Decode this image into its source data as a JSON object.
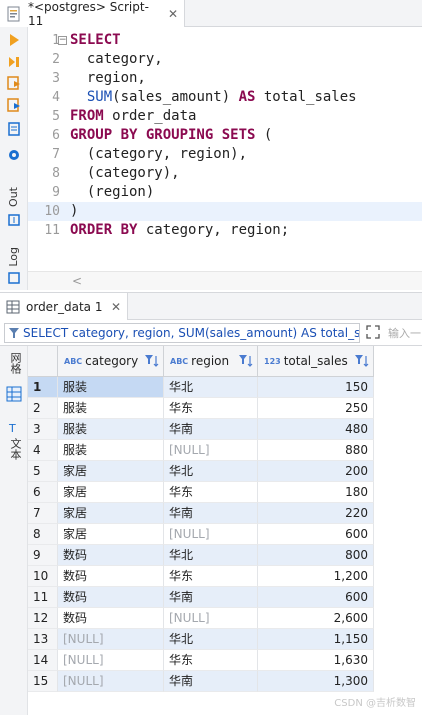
{
  "editor_tab": {
    "title": "*<postgres> Script-11",
    "close": "✕"
  },
  "left_toolbar": {
    "out_label": "Out",
    "log_label": "Log"
  },
  "sql_lines": [
    {
      "num": "1",
      "tokens": [
        {
          "t": "SELECT",
          "c": "kw"
        }
      ]
    },
    {
      "num": "2",
      "tokens": [
        {
          "t": "  category,",
          "c": "pun"
        }
      ]
    },
    {
      "num": "3",
      "tokens": [
        {
          "t": "  region,",
          "c": "pun"
        }
      ]
    },
    {
      "num": "4",
      "tokens": [
        {
          "t": "  ",
          "c": "pun"
        },
        {
          "t": "SUM",
          "c": "fn"
        },
        {
          "t": "(sales_amount) ",
          "c": "pun"
        },
        {
          "t": "AS",
          "c": "kw"
        },
        {
          "t": " total_sales",
          "c": "pun"
        }
      ]
    },
    {
      "num": "5",
      "tokens": [
        {
          "t": "FROM",
          "c": "kw"
        },
        {
          "t": " order_data",
          "c": "pun"
        }
      ]
    },
    {
      "num": "6",
      "tokens": [
        {
          "t": "GROUP BY GROUPING SETS",
          "c": "kw"
        },
        {
          "t": " (",
          "c": "pun"
        }
      ]
    },
    {
      "num": "7",
      "tokens": [
        {
          "t": "  (category, region),",
          "c": "pun"
        }
      ]
    },
    {
      "num": "8",
      "tokens": [
        {
          "t": "  (category),",
          "c": "pun"
        }
      ]
    },
    {
      "num": "9",
      "tokens": [
        {
          "t": "  (region)",
          "c": "pun"
        }
      ]
    },
    {
      "num": "10",
      "tokens": [
        {
          "t": ")",
          "c": "pun"
        }
      ]
    },
    {
      "num": "11",
      "tokens": [
        {
          "t": "ORDER BY",
          "c": "kw"
        },
        {
          "t": " category, region;",
          "c": "pun"
        }
      ]
    }
  ],
  "hscroll_arrow": "<",
  "results_tab": {
    "title": "order_data 1",
    "close": "✕"
  },
  "filter": {
    "value": "SELECT category, region, SUM(sales_amount) AS total_sa",
    "placeholder": "输入一"
  },
  "side_panel": {
    "grid_label": "网格",
    "text_label": "文本"
  },
  "columns": [
    {
      "type": "ABC",
      "name": "category"
    },
    {
      "type": "ABC",
      "name": "region"
    },
    {
      "type": "123",
      "name": "total_sales"
    }
  ],
  "rows": [
    {
      "n": "1",
      "category": "服装",
      "region": "华北",
      "total": "150"
    },
    {
      "n": "2",
      "category": "服装",
      "region": "华东",
      "total": "250"
    },
    {
      "n": "3",
      "category": "服装",
      "region": "华南",
      "total": "480"
    },
    {
      "n": "4",
      "category": "服装",
      "region": "[NULL]",
      "total": "880"
    },
    {
      "n": "5",
      "category": "家居",
      "region": "华北",
      "total": "200"
    },
    {
      "n": "6",
      "category": "家居",
      "region": "华东",
      "total": "180"
    },
    {
      "n": "7",
      "category": "家居",
      "region": "华南",
      "total": "220"
    },
    {
      "n": "8",
      "category": "家居",
      "region": "[NULL]",
      "total": "600"
    },
    {
      "n": "9",
      "category": "数码",
      "region": "华北",
      "total": "800"
    },
    {
      "n": "10",
      "category": "数码",
      "region": "华东",
      "total": "1,200"
    },
    {
      "n": "11",
      "category": "数码",
      "region": "华南",
      "total": "600"
    },
    {
      "n": "12",
      "category": "数码",
      "region": "[NULL]",
      "total": "2,600"
    },
    {
      "n": "13",
      "category": "[NULL]",
      "region": "华北",
      "total": "1,150"
    },
    {
      "n": "14",
      "category": "[NULL]",
      "region": "华东",
      "total": "1,630"
    },
    {
      "n": "15",
      "category": "[NULL]",
      "region": "华南",
      "total": "1,300"
    }
  ],
  "watermark": "CSDN @吉析数智"
}
